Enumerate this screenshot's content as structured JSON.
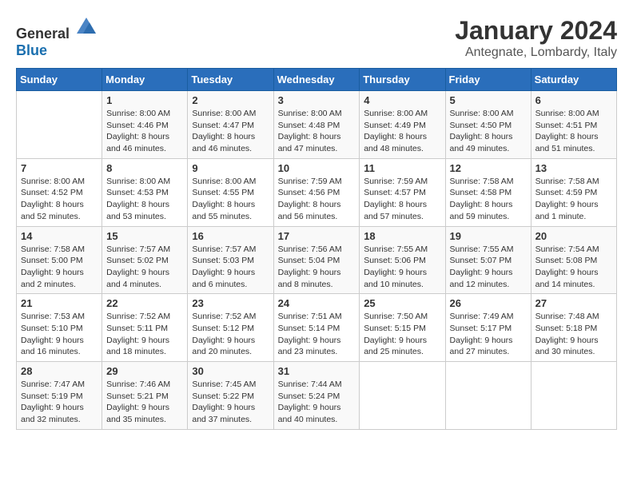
{
  "logo": {
    "text_general": "General",
    "text_blue": "Blue"
  },
  "title": "January 2024",
  "subtitle": "Antegnate, Lombardy, Italy",
  "header": {
    "days": [
      "Sunday",
      "Monday",
      "Tuesday",
      "Wednesday",
      "Thursday",
      "Friday",
      "Saturday"
    ]
  },
  "weeks": [
    {
      "cells": [
        {
          "day": "",
          "sunrise": "",
          "sunset": "",
          "daylight": ""
        },
        {
          "day": "1",
          "sunrise": "Sunrise: 8:00 AM",
          "sunset": "Sunset: 4:46 PM",
          "daylight": "Daylight: 8 hours and 46 minutes."
        },
        {
          "day": "2",
          "sunrise": "Sunrise: 8:00 AM",
          "sunset": "Sunset: 4:47 PM",
          "daylight": "Daylight: 8 hours and 46 minutes."
        },
        {
          "day": "3",
          "sunrise": "Sunrise: 8:00 AM",
          "sunset": "Sunset: 4:48 PM",
          "daylight": "Daylight: 8 hours and 47 minutes."
        },
        {
          "day": "4",
          "sunrise": "Sunrise: 8:00 AM",
          "sunset": "Sunset: 4:49 PM",
          "daylight": "Daylight: 8 hours and 48 minutes."
        },
        {
          "day": "5",
          "sunrise": "Sunrise: 8:00 AM",
          "sunset": "Sunset: 4:50 PM",
          "daylight": "Daylight: 8 hours and 49 minutes."
        },
        {
          "day": "6",
          "sunrise": "Sunrise: 8:00 AM",
          "sunset": "Sunset: 4:51 PM",
          "daylight": "Daylight: 8 hours and 51 minutes."
        }
      ]
    },
    {
      "cells": [
        {
          "day": "7",
          "sunrise": "Sunrise: 8:00 AM",
          "sunset": "Sunset: 4:52 PM",
          "daylight": "Daylight: 8 hours and 52 minutes."
        },
        {
          "day": "8",
          "sunrise": "Sunrise: 8:00 AM",
          "sunset": "Sunset: 4:53 PM",
          "daylight": "Daylight: 8 hours and 53 minutes."
        },
        {
          "day": "9",
          "sunrise": "Sunrise: 8:00 AM",
          "sunset": "Sunset: 4:55 PM",
          "daylight": "Daylight: 8 hours and 55 minutes."
        },
        {
          "day": "10",
          "sunrise": "Sunrise: 7:59 AM",
          "sunset": "Sunset: 4:56 PM",
          "daylight": "Daylight: 8 hours and 56 minutes."
        },
        {
          "day": "11",
          "sunrise": "Sunrise: 7:59 AM",
          "sunset": "Sunset: 4:57 PM",
          "daylight": "Daylight: 8 hours and 57 minutes."
        },
        {
          "day": "12",
          "sunrise": "Sunrise: 7:58 AM",
          "sunset": "Sunset: 4:58 PM",
          "daylight": "Daylight: 8 hours and 59 minutes."
        },
        {
          "day": "13",
          "sunrise": "Sunrise: 7:58 AM",
          "sunset": "Sunset: 4:59 PM",
          "daylight": "Daylight: 9 hours and 1 minute."
        }
      ]
    },
    {
      "cells": [
        {
          "day": "14",
          "sunrise": "Sunrise: 7:58 AM",
          "sunset": "Sunset: 5:00 PM",
          "daylight": "Daylight: 9 hours and 2 minutes."
        },
        {
          "day": "15",
          "sunrise": "Sunrise: 7:57 AM",
          "sunset": "Sunset: 5:02 PM",
          "daylight": "Daylight: 9 hours and 4 minutes."
        },
        {
          "day": "16",
          "sunrise": "Sunrise: 7:57 AM",
          "sunset": "Sunset: 5:03 PM",
          "daylight": "Daylight: 9 hours and 6 minutes."
        },
        {
          "day": "17",
          "sunrise": "Sunrise: 7:56 AM",
          "sunset": "Sunset: 5:04 PM",
          "daylight": "Daylight: 9 hours and 8 minutes."
        },
        {
          "day": "18",
          "sunrise": "Sunrise: 7:55 AM",
          "sunset": "Sunset: 5:06 PM",
          "daylight": "Daylight: 9 hours and 10 minutes."
        },
        {
          "day": "19",
          "sunrise": "Sunrise: 7:55 AM",
          "sunset": "Sunset: 5:07 PM",
          "daylight": "Daylight: 9 hours and 12 minutes."
        },
        {
          "day": "20",
          "sunrise": "Sunrise: 7:54 AM",
          "sunset": "Sunset: 5:08 PM",
          "daylight": "Daylight: 9 hours and 14 minutes."
        }
      ]
    },
    {
      "cells": [
        {
          "day": "21",
          "sunrise": "Sunrise: 7:53 AM",
          "sunset": "Sunset: 5:10 PM",
          "daylight": "Daylight: 9 hours and 16 minutes."
        },
        {
          "day": "22",
          "sunrise": "Sunrise: 7:52 AM",
          "sunset": "Sunset: 5:11 PM",
          "daylight": "Daylight: 9 hours and 18 minutes."
        },
        {
          "day": "23",
          "sunrise": "Sunrise: 7:52 AM",
          "sunset": "Sunset: 5:12 PM",
          "daylight": "Daylight: 9 hours and 20 minutes."
        },
        {
          "day": "24",
          "sunrise": "Sunrise: 7:51 AM",
          "sunset": "Sunset: 5:14 PM",
          "daylight": "Daylight: 9 hours and 23 minutes."
        },
        {
          "day": "25",
          "sunrise": "Sunrise: 7:50 AM",
          "sunset": "Sunset: 5:15 PM",
          "daylight": "Daylight: 9 hours and 25 minutes."
        },
        {
          "day": "26",
          "sunrise": "Sunrise: 7:49 AM",
          "sunset": "Sunset: 5:17 PM",
          "daylight": "Daylight: 9 hours and 27 minutes."
        },
        {
          "day": "27",
          "sunrise": "Sunrise: 7:48 AM",
          "sunset": "Sunset: 5:18 PM",
          "daylight": "Daylight: 9 hours and 30 minutes."
        }
      ]
    },
    {
      "cells": [
        {
          "day": "28",
          "sunrise": "Sunrise: 7:47 AM",
          "sunset": "Sunset: 5:19 PM",
          "daylight": "Daylight: 9 hours and 32 minutes."
        },
        {
          "day": "29",
          "sunrise": "Sunrise: 7:46 AM",
          "sunset": "Sunset: 5:21 PM",
          "daylight": "Daylight: 9 hours and 35 minutes."
        },
        {
          "day": "30",
          "sunrise": "Sunrise: 7:45 AM",
          "sunset": "Sunset: 5:22 PM",
          "daylight": "Daylight: 9 hours and 37 minutes."
        },
        {
          "day": "31",
          "sunrise": "Sunrise: 7:44 AM",
          "sunset": "Sunset: 5:24 PM",
          "daylight": "Daylight: 9 hours and 40 minutes."
        },
        {
          "day": "",
          "sunrise": "",
          "sunset": "",
          "daylight": ""
        },
        {
          "day": "",
          "sunrise": "",
          "sunset": "",
          "daylight": ""
        },
        {
          "day": "",
          "sunrise": "",
          "sunset": "",
          "daylight": ""
        }
      ]
    }
  ]
}
